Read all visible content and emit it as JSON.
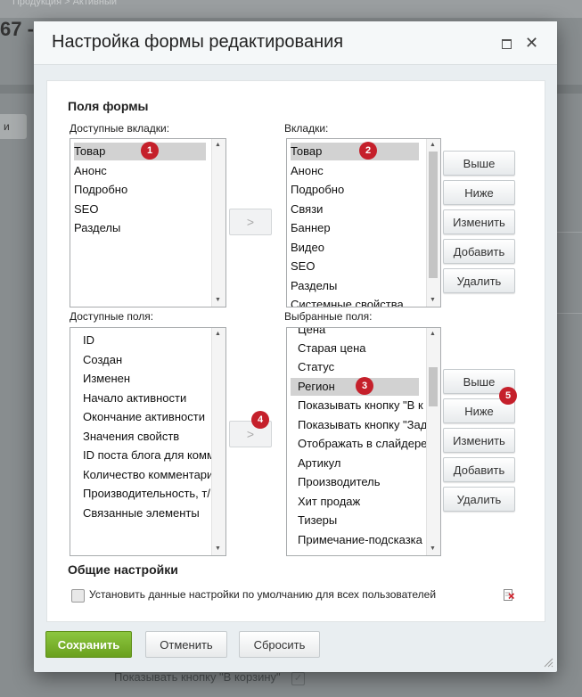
{
  "background": {
    "breadcrumb": "Продукция  >  Активный",
    "page_title": "67 -",
    "left_btn": "и",
    "bottom_text": "Показывать кнопку \"В корзину\""
  },
  "dialog": {
    "title": "Настройка формы редактирования",
    "section_fields": "Поля формы",
    "available_tabs_label": "Доступные вкладки:",
    "tabs_label": "Вкладки:",
    "available_fields_label": "Доступные поля:",
    "selected_fields_label": "Выбранные поля:",
    "available_tabs": [
      "Товар",
      "Анонс",
      "Подробно",
      "SEO",
      "Разделы"
    ],
    "tabs": [
      "Товар",
      "Анонс",
      "Подробно",
      "Связи",
      "Баннер",
      "Видео",
      "SEO",
      "Разделы",
      "Системные свойства"
    ],
    "available_fields": [
      "ID",
      "Создан",
      "Изменен",
      "Начало активности",
      "Окончание активности",
      "Значения свойств",
      "ID поста блога для комм",
      "Количество комментари",
      "Производительность, т/",
      "Связанные элементы"
    ],
    "selected_fields": [
      "Цена",
      "Старая цена",
      "Статус",
      "Регион",
      "Показывать кнопку \"В к",
      "Показывать кнопку \"Зад",
      "Отображать в слайдере",
      "Артикул",
      "Производитель",
      "Хит продаж",
      "Тизеры",
      "Примечание-подсказка"
    ],
    "move_label": ">",
    "buttons": {
      "up": "Выше",
      "down": "Ниже",
      "edit": "Изменить",
      "add": "Добавить",
      "delete": "Удалить"
    },
    "section_general": "Общие настройки",
    "default_checkbox_label": "Установить данные настройки по умолчанию для всех пользователей",
    "badges": [
      "1",
      "2",
      "3",
      "4",
      "5"
    ]
  },
  "footer": {
    "save": "Сохранить",
    "cancel": "Отменить",
    "reset": "Сбросить"
  },
  "colors": {
    "badge": "#c5202b",
    "save": "#7ab32e"
  }
}
